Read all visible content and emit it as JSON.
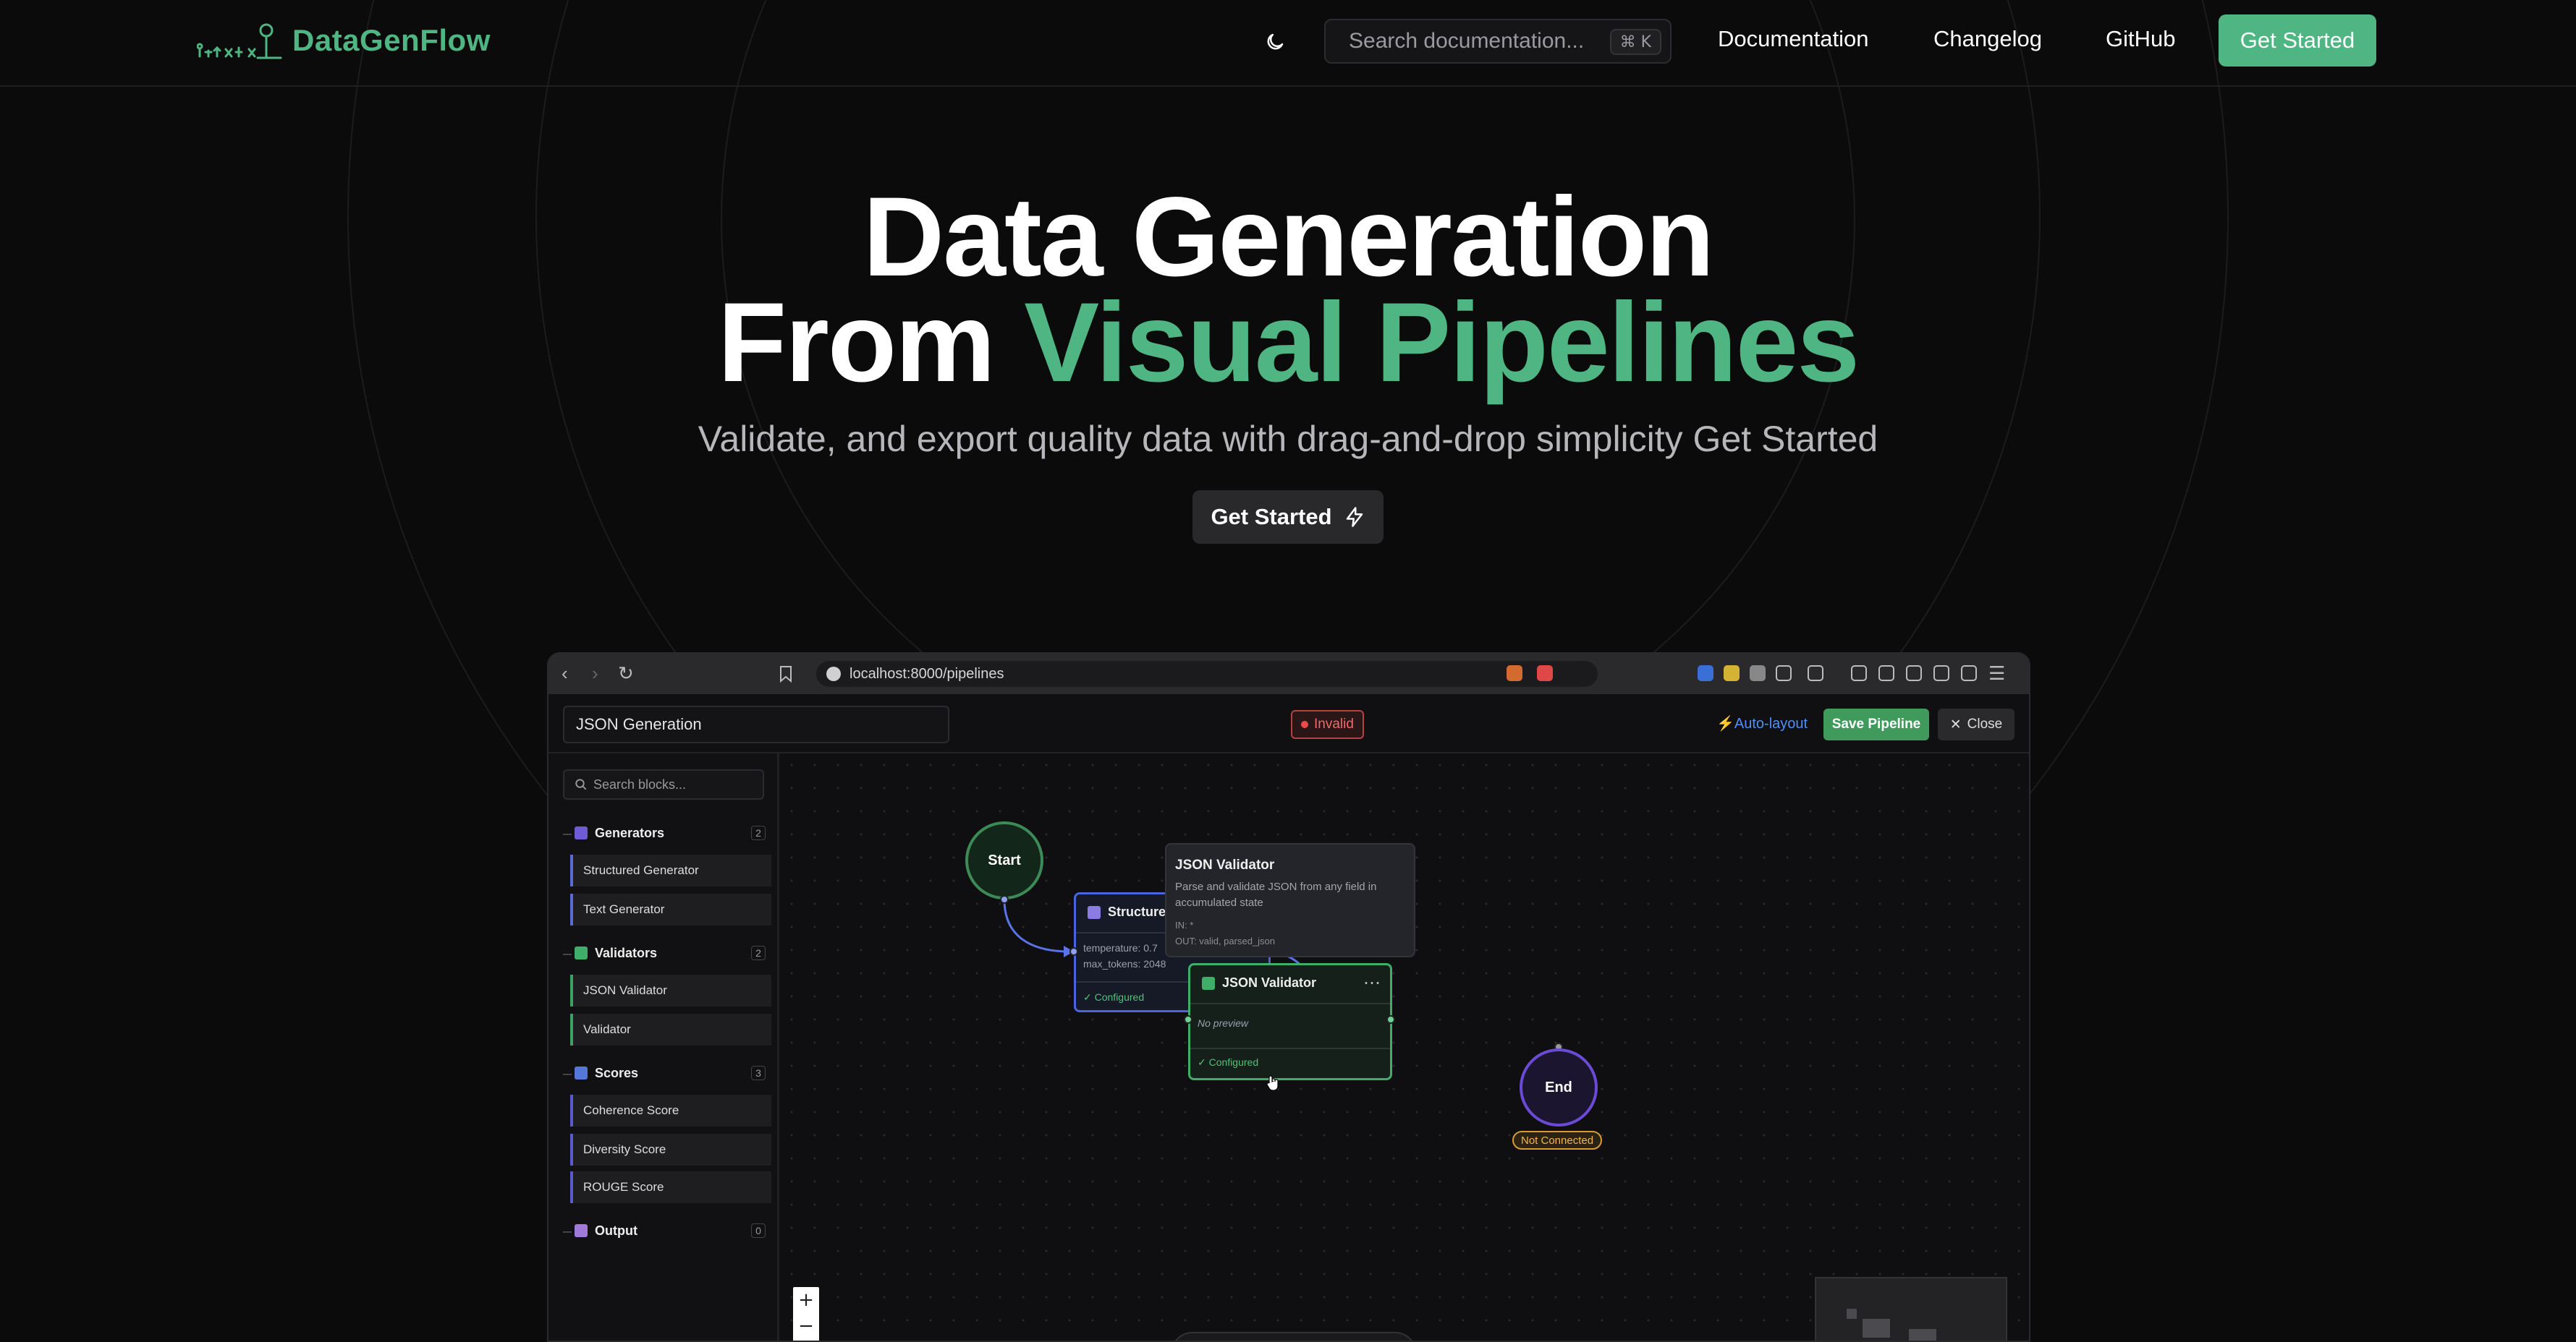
{
  "header": {
    "brand": "DataGenFlow",
    "search_placeholder": "Search documentation...",
    "search_shortcut": "⌘ K",
    "nav": [
      "Documentation",
      "Changelog",
      "GitHub"
    ],
    "cta_label": "Get Started",
    "accent_color": "#4fb582"
  },
  "hero": {
    "title_line1": "Data Generation",
    "title_line2_plain": "From ",
    "title_line2_accent": "Visual Pipelines",
    "subtitle": "Validate, and export quality data with drag-and-drop simplicity Get Started",
    "button_label": "Get Started"
  },
  "browser": {
    "url": "localhost:8000/pipelines"
  },
  "app": {
    "pipeline_name": "JSON Generation",
    "status_badge": "Invalid",
    "auto_layout_label": "Auto-layout",
    "save_label": "Save Pipeline",
    "close_label": "Close",
    "sidebar": {
      "search_placeholder": "Search blocks...",
      "categories": [
        {
          "name": "Generators",
          "count": "2",
          "items": [
            "Structured Generator",
            "Text Generator"
          ]
        },
        {
          "name": "Validators",
          "count": "2",
          "items": [
            "JSON Validator",
            "Validator"
          ]
        },
        {
          "name": "Scores",
          "count": "3",
          "items": [
            "Coherence Score",
            "Diversity Score",
            "ROUGE Score"
          ]
        },
        {
          "name": "Output",
          "count": "0",
          "items": []
        }
      ]
    },
    "canvas": {
      "start_label": "Start",
      "end_label": "End",
      "end_status": "Not Connected",
      "structured_generator": {
        "title": "Structured Generator",
        "params": [
          "temperature: 0.7",
          "max_tokens: 2048"
        ],
        "status": "✓ Configured"
      },
      "json_validator": {
        "title": "JSON Validator",
        "preview": "No preview",
        "status": "✓ Configured"
      },
      "tooltip": {
        "title": "JSON Validator",
        "description": "Parse and validate JSON from any field in accumulated state",
        "inputs": "IN: *",
        "outputs": "OUT: valid, parsed_json"
      },
      "zoom_in": "+",
      "zoom_out": "−"
    }
  }
}
